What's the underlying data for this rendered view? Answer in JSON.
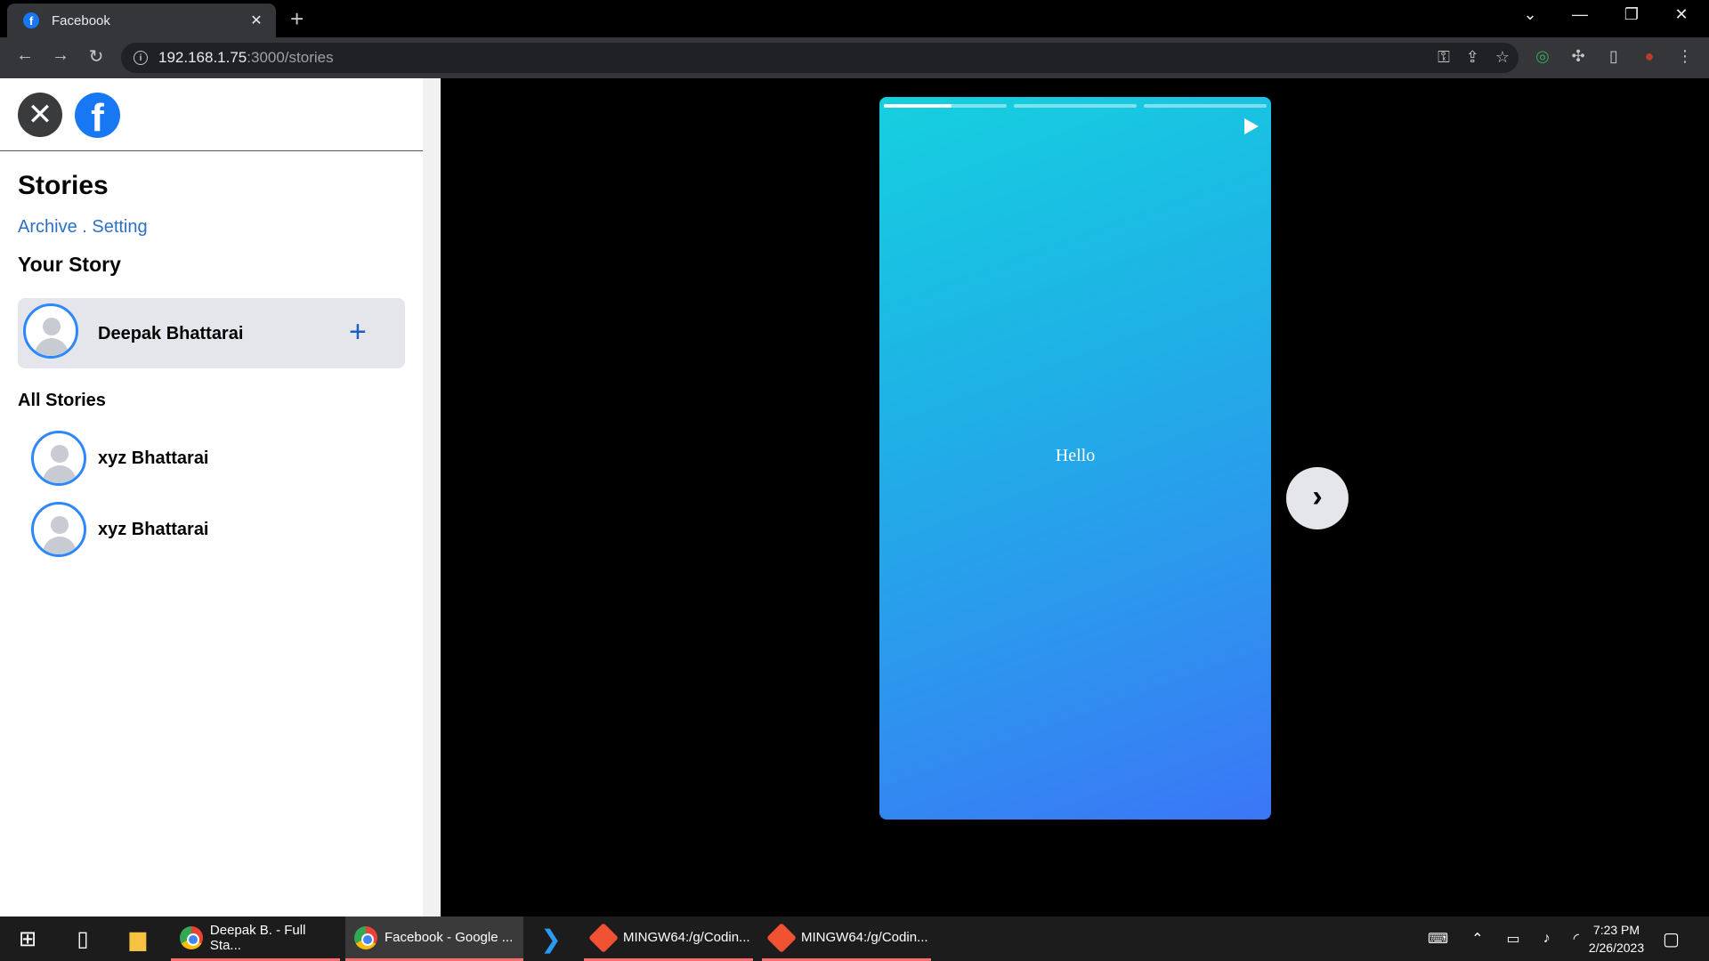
{
  "browser": {
    "tab_title": "Facebook",
    "tab_favicon": "f",
    "url_host": "192.168.1.75",
    "url_path": ":3000/stories"
  },
  "sidebar": {
    "title": "Stories",
    "links": "Archive . Setting",
    "your_story_heading": "Your Story",
    "my_story": {
      "name": "Deepak Bhattarai",
      "add_label": "+"
    },
    "all_stories_heading": "All Stories",
    "stories": [
      {
        "name": "xyz Bhattarai"
      },
      {
        "name": "xyz Bhattarai"
      }
    ]
  },
  "viewer": {
    "story_text": "Hello",
    "progress": [
      0.55,
      0,
      0
    ],
    "gradient": [
      "#15d0df",
      "#3b76f7"
    ]
  },
  "taskbar": {
    "apps": [
      {
        "label": "Deepak B. - Full Sta...",
        "icon": "chrome-icon"
      },
      {
        "label": "Facebook - Google ...",
        "icon": "chrome-icon"
      },
      {
        "label": "MINGW64:/g/Codin...",
        "icon": "git-icon"
      },
      {
        "label": "MINGW64:/g/Codin...",
        "icon": "git-icon"
      }
    ],
    "time": "7:23 PM",
    "date": "2/26/2023"
  }
}
